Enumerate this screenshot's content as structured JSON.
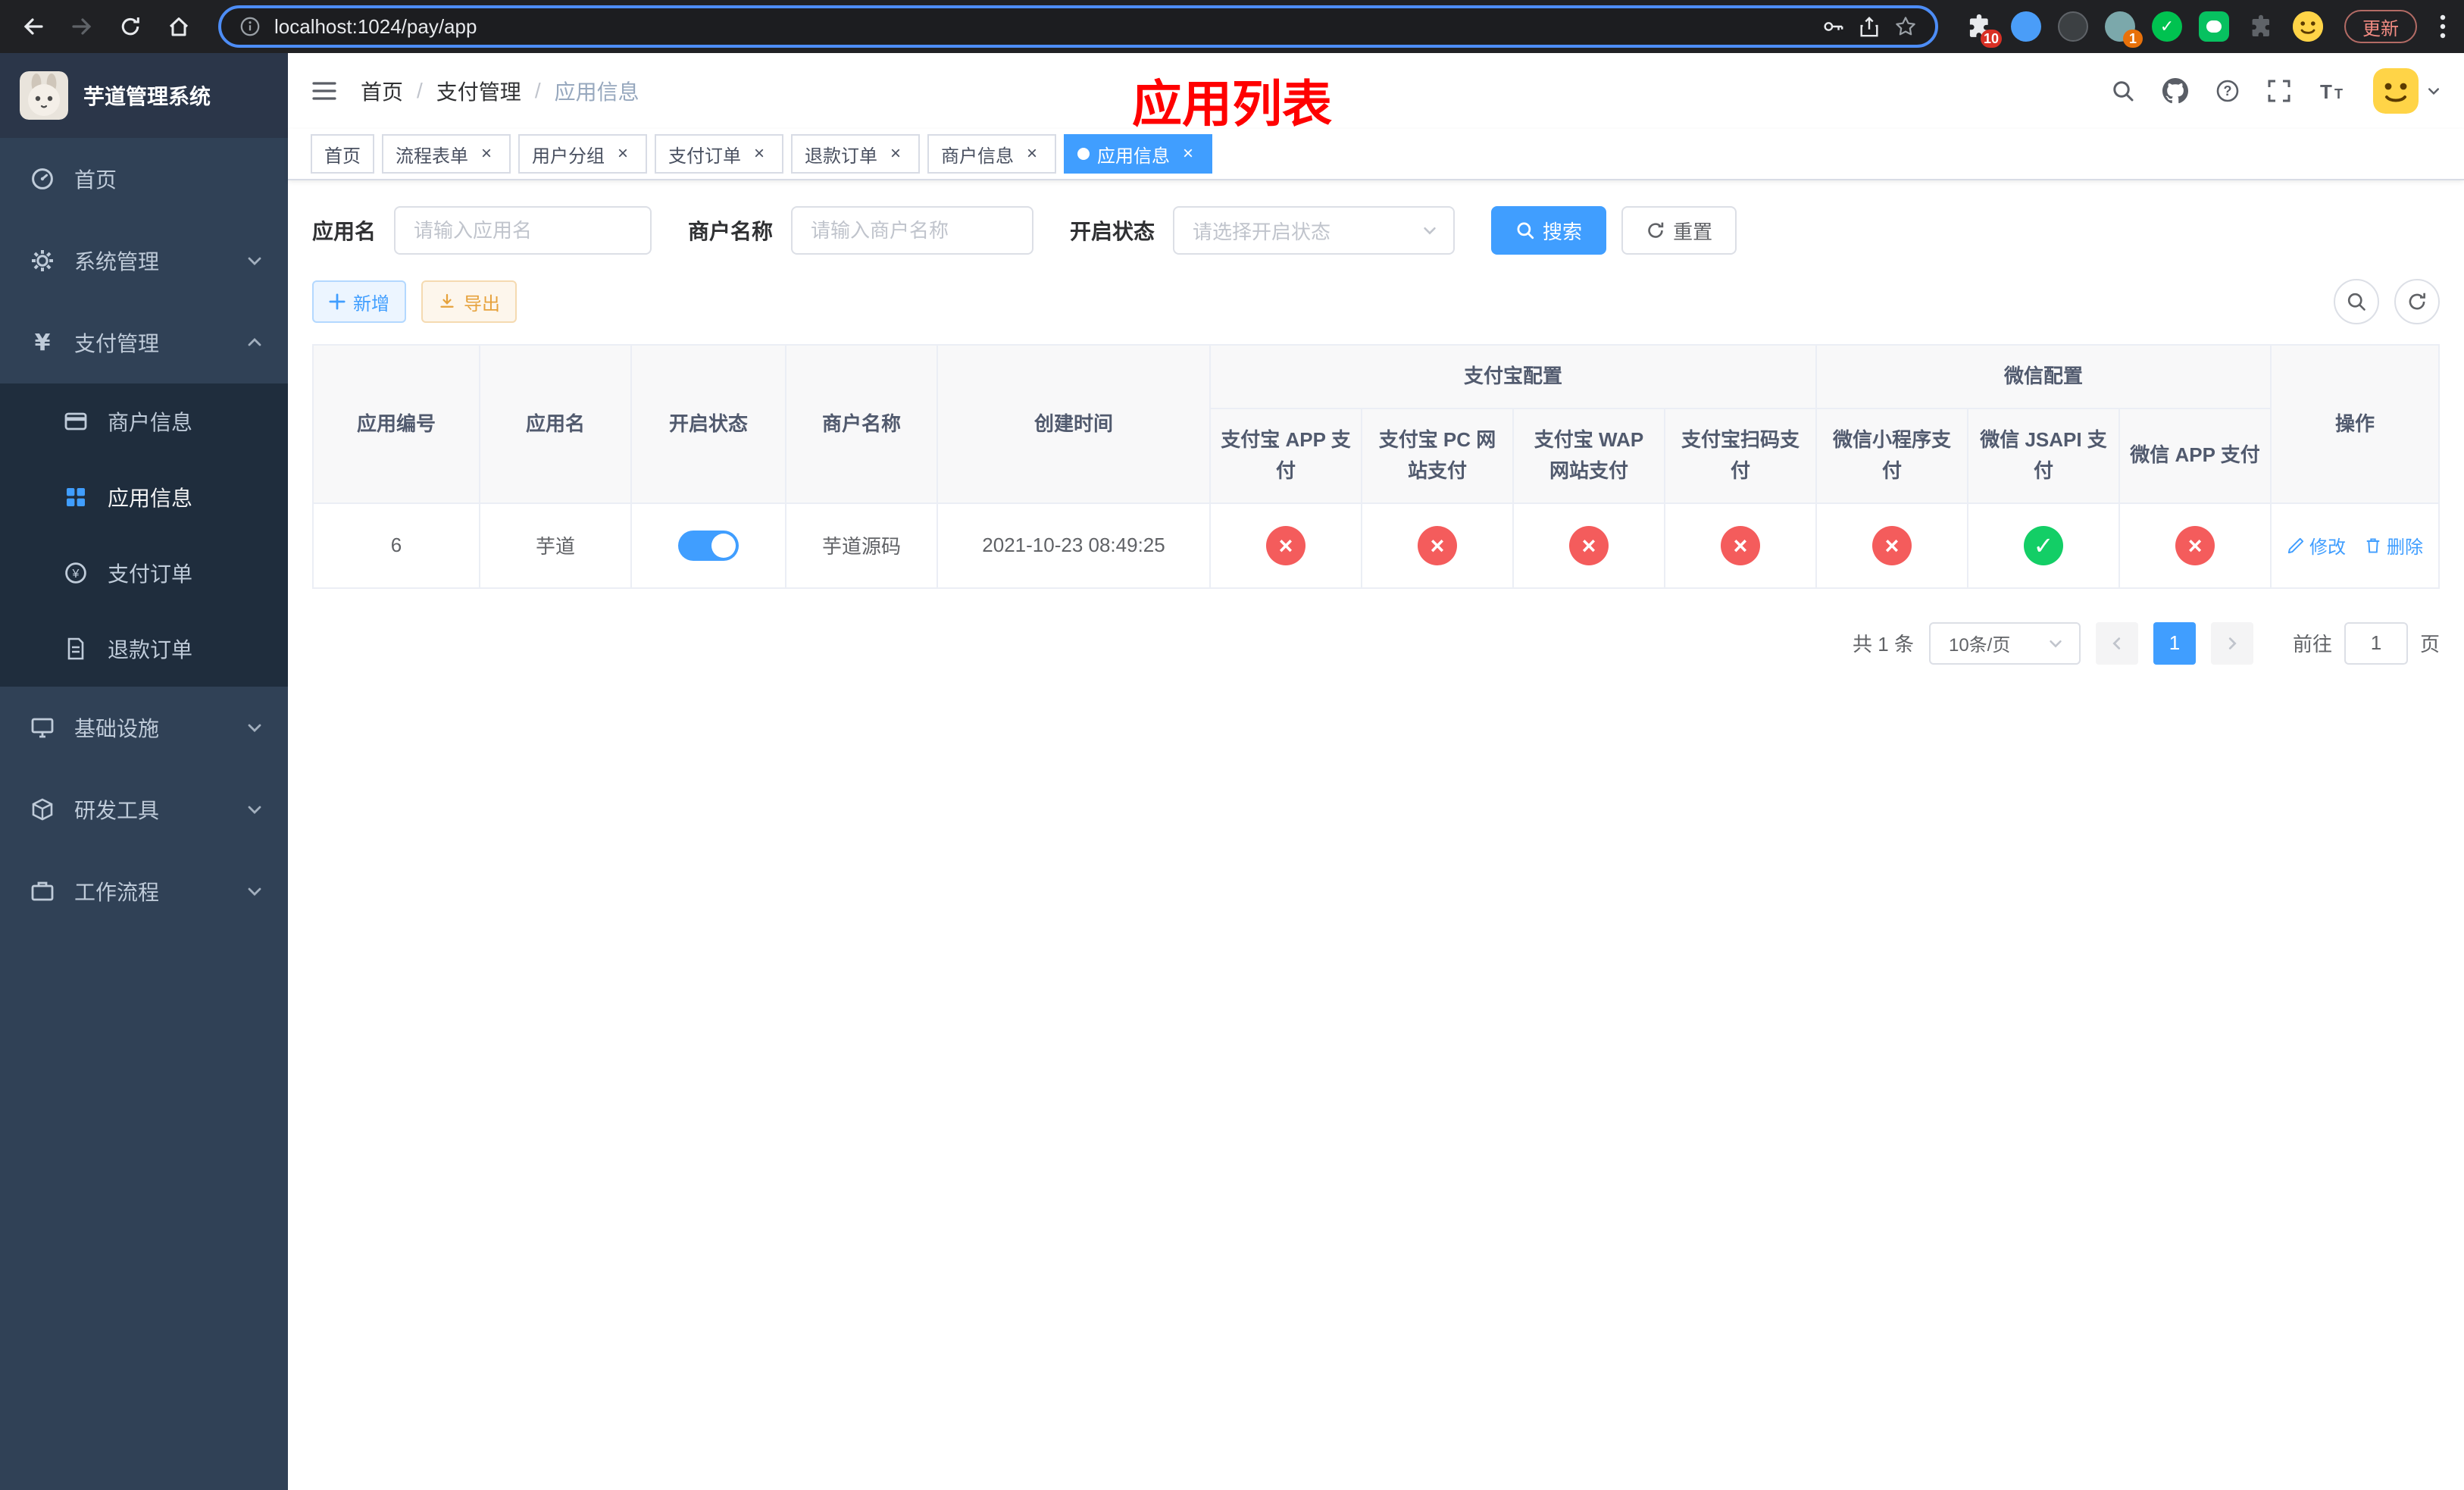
{
  "colors": {
    "accent_blue": "#409EFF",
    "success_green": "#13ce66",
    "danger_red": "#f45c5c",
    "warning_orange": "#E6A23C",
    "sidebar_bg": "#304156",
    "sidebar_submenu_bg": "#1f2d3d",
    "overlay_title_red": "#ff0000"
  },
  "browser": {
    "url": "localhost:1024/pay/app",
    "update_label": "更新",
    "extensions_badge": "10",
    "profile_badge": "1"
  },
  "sidebar": {
    "title": "芋道管理系统",
    "menu": [
      {
        "label": "首页"
      },
      {
        "label": "系统管理"
      },
      {
        "label": "支付管理"
      },
      {
        "label": "基础设施"
      },
      {
        "label": "研发工具"
      },
      {
        "label": "工作流程"
      }
    ],
    "payment_children": [
      {
        "label": "商户信息"
      },
      {
        "label": "应用信息"
      },
      {
        "label": "支付订单"
      },
      {
        "label": "退款订单"
      }
    ]
  },
  "header": {
    "breadcrumb": [
      "首页",
      "支付管理",
      "应用信息"
    ],
    "overlay_title": "应用列表"
  },
  "tabs": [
    {
      "label": "首页"
    },
    {
      "label": "流程表单"
    },
    {
      "label": "用户分组"
    },
    {
      "label": "支付订单"
    },
    {
      "label": "退款订单"
    },
    {
      "label": "商户信息"
    },
    {
      "label": "应用信息"
    }
  ],
  "filters": {
    "app_name_label": "应用名",
    "app_name_placeholder": "请输入应用名",
    "merchant_label": "商户名称",
    "merchant_placeholder": "请输入商户名称",
    "status_label": "开启状态",
    "status_placeholder": "请选择开启状态",
    "search_label": "搜索",
    "reset_label": "重置"
  },
  "toolbar": {
    "add_label": "新增",
    "export_label": "导出"
  },
  "table": {
    "columns": {
      "app_id": "应用编号",
      "app_name": "应用名",
      "status": "开启状态",
      "merchant": "商户名称",
      "created_at": "创建时间",
      "alipay_group": "支付宝配置",
      "wechat_group": "微信配置",
      "actions": "操作",
      "alipay_sub": [
        "支付宝 APP 支付",
        "支付宝 PC 网站支付",
        "支付宝 WAP 网站支付",
        "支付宝扫码支付"
      ],
      "wechat_sub": [
        "微信小程序支付",
        "微信 JSAPI 支付",
        "微信 APP 支付"
      ]
    },
    "rows": [
      {
        "app_id": "6",
        "app_name": "芋道",
        "status_on": true,
        "merchant": "芋道源码",
        "created_at": "2021-10-23 08:49:25",
        "alipay_enabled": [
          false,
          false,
          false,
          false
        ],
        "wechat_enabled": [
          false,
          true,
          false
        ],
        "edit_label": "修改",
        "delete_label": "删除"
      }
    ]
  },
  "pagination": {
    "total_text": "共 1 条",
    "page_size_text": "10条/页",
    "current_page": "1",
    "goto_prefix": "前往",
    "goto_value": "1",
    "goto_suffix": "页"
  }
}
